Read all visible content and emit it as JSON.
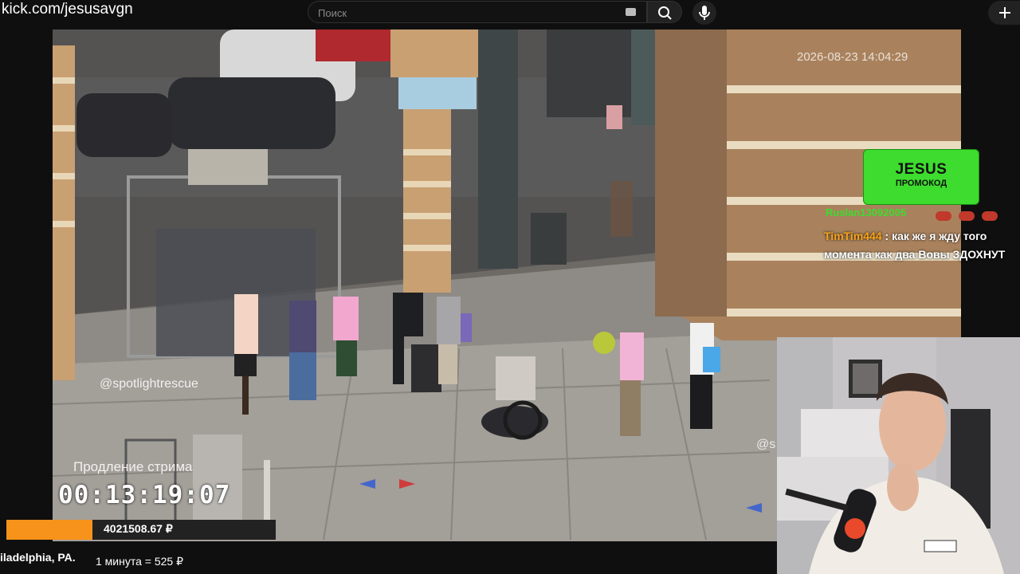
{
  "browser": {
    "url": "kick.com/jesusavgn",
    "search_placeholder": "Поиск"
  },
  "icons": {
    "search": "search-icon",
    "mic": "mic-icon",
    "create": "plus-icon",
    "keyboard": "keyboard-icon"
  },
  "video": {
    "timestamp": "2026-08-23 14:04:29",
    "watermark": "@spotlightrescue",
    "watermark_partial": "@s"
  },
  "stream_overlay": {
    "extension_label": "Продление стрима",
    "extension_time": "00:13:19:07",
    "donation_total": "4021508.67 ₽",
    "donation_fill_fraction": 0.32,
    "rate_text": "1 минута = 525 ₽",
    "caption": "iladelphia, PA.",
    "promo_title": "JESUS",
    "promo_subtitle": "ПРОМОКОД"
  },
  "chat": {
    "prev_user": "Ruslan13092005",
    "user": "TimTim444",
    "separator": " : ",
    "message": "как же я жду того момента как два Вовы ЗДОХНУТ"
  },
  "colors": {
    "accent_orange": "#f7931a",
    "promo_green": "#3ddc2e",
    "chat_user": "#f7a31a"
  }
}
